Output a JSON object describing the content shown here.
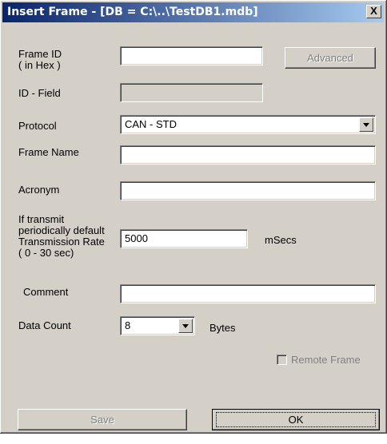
{
  "window": {
    "title": "Insert Frame - [DB = C:\\..\\TestDB1.mdb]",
    "close_glyph": "X"
  },
  "labels": {
    "frame_id_line1": "Frame ID",
    "frame_id_line2": "( in Hex )",
    "id_field": "ID - Field",
    "protocol": "Protocol",
    "frame_name": "Frame Name",
    "acronym": "Acronym",
    "rate_line1": "If transmit",
    "rate_line2": "periodically default",
    "rate_line3": "Transmission Rate",
    "rate_line4": "( 0 - 30 sec)",
    "rate_unit": "mSecs",
    "comment": "Comment",
    "data_count": "Data Count",
    "bytes": "Bytes"
  },
  "fields": {
    "frame_id": "",
    "id_field": "",
    "protocol": "CAN - STD",
    "frame_name": "",
    "acronym": "",
    "transmission_rate": "5000",
    "comment": "",
    "data_count": "8"
  },
  "buttons": {
    "advanced": "Advanced",
    "save": "Save",
    "ok": "OK"
  },
  "remote_frame": {
    "label": "Remote Frame",
    "checked": false
  }
}
